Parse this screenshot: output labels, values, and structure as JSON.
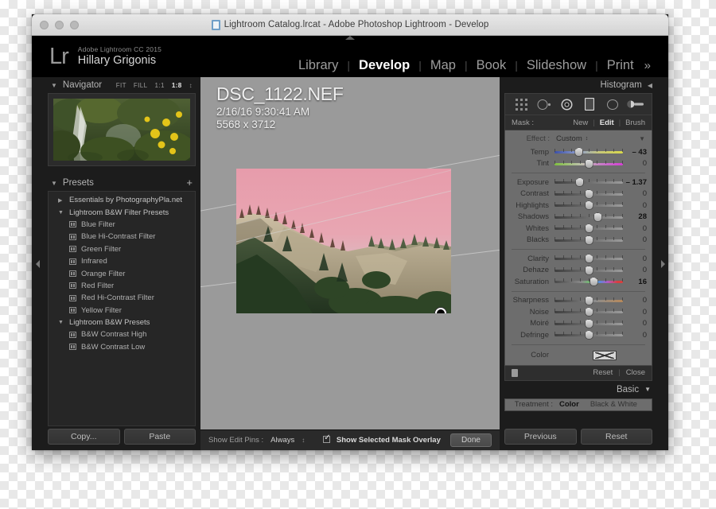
{
  "window": {
    "title": "Lightroom Catalog.lrcat - Adobe Photoshop Lightroom - Develop",
    "doc_icon": "lrcat-document-icon"
  },
  "identity": {
    "logo": "Lr",
    "product": "Adobe Lightroom CC 2015",
    "user": "Hillary Grigonis"
  },
  "modules": {
    "items": [
      {
        "label": "Library",
        "active": false
      },
      {
        "label": "Develop",
        "active": true
      },
      {
        "label": "Map",
        "active": false
      },
      {
        "label": "Book",
        "active": false
      },
      {
        "label": "Slideshow",
        "active": false
      },
      {
        "label": "Print",
        "active": false
      }
    ],
    "overflow": "»",
    "separator": "|"
  },
  "navigator": {
    "title": "Navigator",
    "twisty": "▼",
    "zoom_levels": [
      {
        "label": "FIT",
        "active": false
      },
      {
        "label": "FILL",
        "active": false
      },
      {
        "label": "1:1",
        "active": false
      },
      {
        "label": "1:8",
        "active": true
      }
    ],
    "stepper": "↕"
  },
  "presets": {
    "title": "Presets",
    "twisty": "▼",
    "add": "+",
    "items": [
      {
        "label": "Essentials by PhotographyPla.net",
        "type": "group",
        "expanded": false,
        "arrow": "▶"
      },
      {
        "label": "Lightroom B&W Filter Presets",
        "type": "group",
        "expanded": true,
        "arrow": "▼"
      },
      {
        "label": "Blue Filter",
        "type": "preset"
      },
      {
        "label": "Blue Hi-Contrast Filter",
        "type": "preset"
      },
      {
        "label": "Green Filter",
        "type": "preset"
      },
      {
        "label": "Infrared",
        "type": "preset"
      },
      {
        "label": "Orange Filter",
        "type": "preset"
      },
      {
        "label": "Red Filter",
        "type": "preset"
      },
      {
        "label": "Red Hi-Contrast Filter",
        "type": "preset"
      },
      {
        "label": "Yellow Filter",
        "type": "preset"
      },
      {
        "label": "Lightroom B&W Presets",
        "type": "group",
        "expanded": true,
        "arrow": "▼"
      },
      {
        "label": "B&W Contrast High",
        "type": "preset"
      },
      {
        "label": "B&W Contrast Low",
        "type": "preset"
      }
    ]
  },
  "left_buttons": {
    "copy": "Copy...",
    "paste": "Paste"
  },
  "photo": {
    "filename": "DSC_1122.NEF",
    "datetime": "2/16/16 9:30:41 AM",
    "dimensions": "5568 x 3712",
    "mask_pin": "edit-pin"
  },
  "toolbar": {
    "show_edit_pins_label": "Show Edit Pins :",
    "show_edit_pins_value": "Always",
    "stepper": "↕",
    "overlay_label": "Show Selected Mask Overlay",
    "overlay_checked": true,
    "done": "Done"
  },
  "histogram": {
    "title": "Histogram",
    "collapse": "◀"
  },
  "tools": [
    {
      "name": "crop-overlay-tool",
      "selected": false
    },
    {
      "name": "spot-removal-tool",
      "selected": false
    },
    {
      "name": "red-eye-correction-tool",
      "selected": true
    },
    {
      "name": "graduated-filter-tool",
      "selected": false
    },
    {
      "name": "radial-filter-tool",
      "selected": false
    },
    {
      "name": "adjustment-brush-tool",
      "selected": false
    }
  ],
  "mask": {
    "label": "Mask :",
    "new": "New",
    "edit": "Edit",
    "brush": "Brush",
    "active": "Edit",
    "divider": "|"
  },
  "effect": {
    "label": "Effect :",
    "value": "Custom",
    "stepper": "↕",
    "twisty": "▼",
    "groups": [
      {
        "sliders": [
          {
            "name": "Temp",
            "value": "– 43",
            "pos": 36,
            "gradient": "temp",
            "modified": true
          },
          {
            "name": "Tint",
            "value": "0",
            "pos": 50,
            "gradient": "tint",
            "modified": false
          }
        ]
      },
      {
        "sliders": [
          {
            "name": "Exposure",
            "value": "– 1.37",
            "pos": 37,
            "gradient": "none",
            "modified": true
          },
          {
            "name": "Contrast",
            "value": "0",
            "pos": 50,
            "gradient": "none",
            "modified": false
          },
          {
            "name": "Highlights",
            "value": "0",
            "pos": 50,
            "gradient": "none",
            "modified": false
          },
          {
            "name": "Shadows",
            "value": "28",
            "pos": 63,
            "gradient": "none",
            "modified": true
          },
          {
            "name": "Whites",
            "value": "0",
            "pos": 50,
            "gradient": "none",
            "modified": false
          },
          {
            "name": "Blacks",
            "value": "0",
            "pos": 50,
            "gradient": "none",
            "modified": false
          }
        ]
      },
      {
        "sliders": [
          {
            "name": "Clarity",
            "value": "0",
            "pos": 50,
            "gradient": "none",
            "modified": false
          },
          {
            "name": "Dehaze",
            "value": "0",
            "pos": 50,
            "gradient": "none",
            "modified": false
          },
          {
            "name": "Saturation",
            "value": "16",
            "pos": 57,
            "gradient": "sat",
            "modified": true
          }
        ]
      },
      {
        "sliders": [
          {
            "name": "Sharpness",
            "value": "0",
            "pos": 50,
            "gradient": "sharp",
            "modified": false
          },
          {
            "name": "Noise",
            "value": "0",
            "pos": 50,
            "gradient": "none",
            "modified": false
          },
          {
            "name": "Moiré",
            "value": "0",
            "pos": 50,
            "gradient": "none",
            "modified": false
          },
          {
            "name": "Defringe",
            "value": "0",
            "pos": 50,
            "gradient": "none",
            "modified": false
          }
        ]
      }
    ],
    "color_label": "Color",
    "footer": {
      "reset": "Reset",
      "close": "Close",
      "divider": "|",
      "switch": "panel-switch-icon"
    }
  },
  "basic": {
    "title": "Basic",
    "twisty": "▼",
    "treatment_label": "Treatment :",
    "treatment_color": "Color",
    "treatment_bw": "Black & White"
  },
  "right_buttons": {
    "previous": "Previous",
    "reset": "Reset"
  },
  "colors": {
    "panel_bg": "#1c1c1c",
    "effect_panel_bg": "#6d6d6d",
    "center_bg": "#9a9a9a",
    "accent_text": "#ffffff",
    "mask_overlay": "#e8a0ae"
  }
}
